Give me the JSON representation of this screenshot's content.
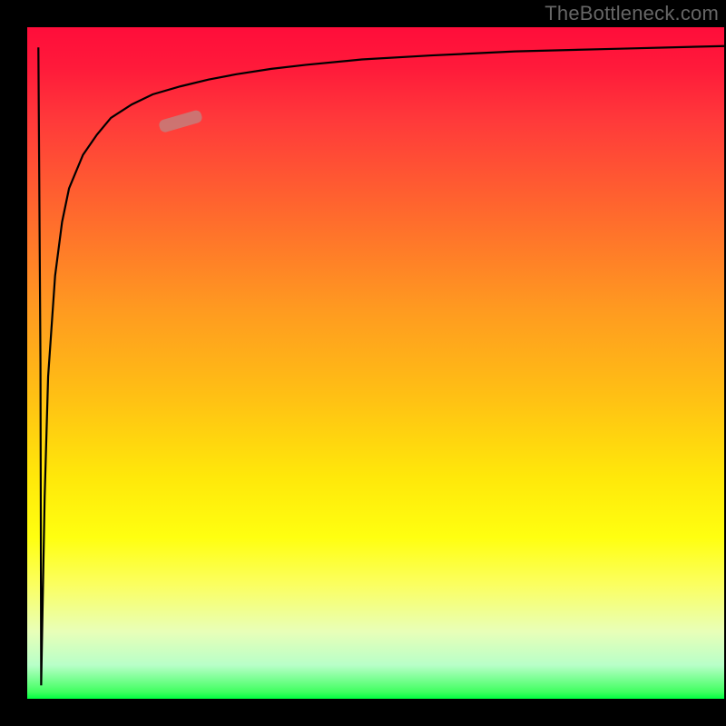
{
  "watermark": "TheBottleneck.com",
  "colors": {
    "page_bg": "#000000",
    "curve": "#000000",
    "marker": "#c87a78",
    "gradient_top": "#ff0d3a",
    "gradient_bottom": "#00ff40"
  },
  "chart_data": {
    "type": "line",
    "title": "",
    "xlabel": "",
    "ylabel": "",
    "xlim": [
      0,
      100
    ],
    "ylim": [
      0,
      100
    ],
    "grid": false,
    "legend": false,
    "series": [
      {
        "name": "bottleneck-curve",
        "x": [
          2,
          2.5,
          3,
          4,
          5,
          6,
          8,
          10,
          12,
          15,
          18,
          22,
          26,
          30,
          35,
          40,
          48,
          58,
          70,
          85,
          100
        ],
        "y": [
          2,
          30,
          48,
          63,
          71,
          76,
          81,
          84,
          86.5,
          88.5,
          90,
          91.2,
          92.2,
          93,
          93.8,
          94.4,
          95.2,
          95.8,
          96.4,
          96.8,
          97.2
        ]
      }
    ],
    "marker": {
      "x": 22,
      "y": 86,
      "series": "bottleneck-curve"
    },
    "annotations": []
  }
}
